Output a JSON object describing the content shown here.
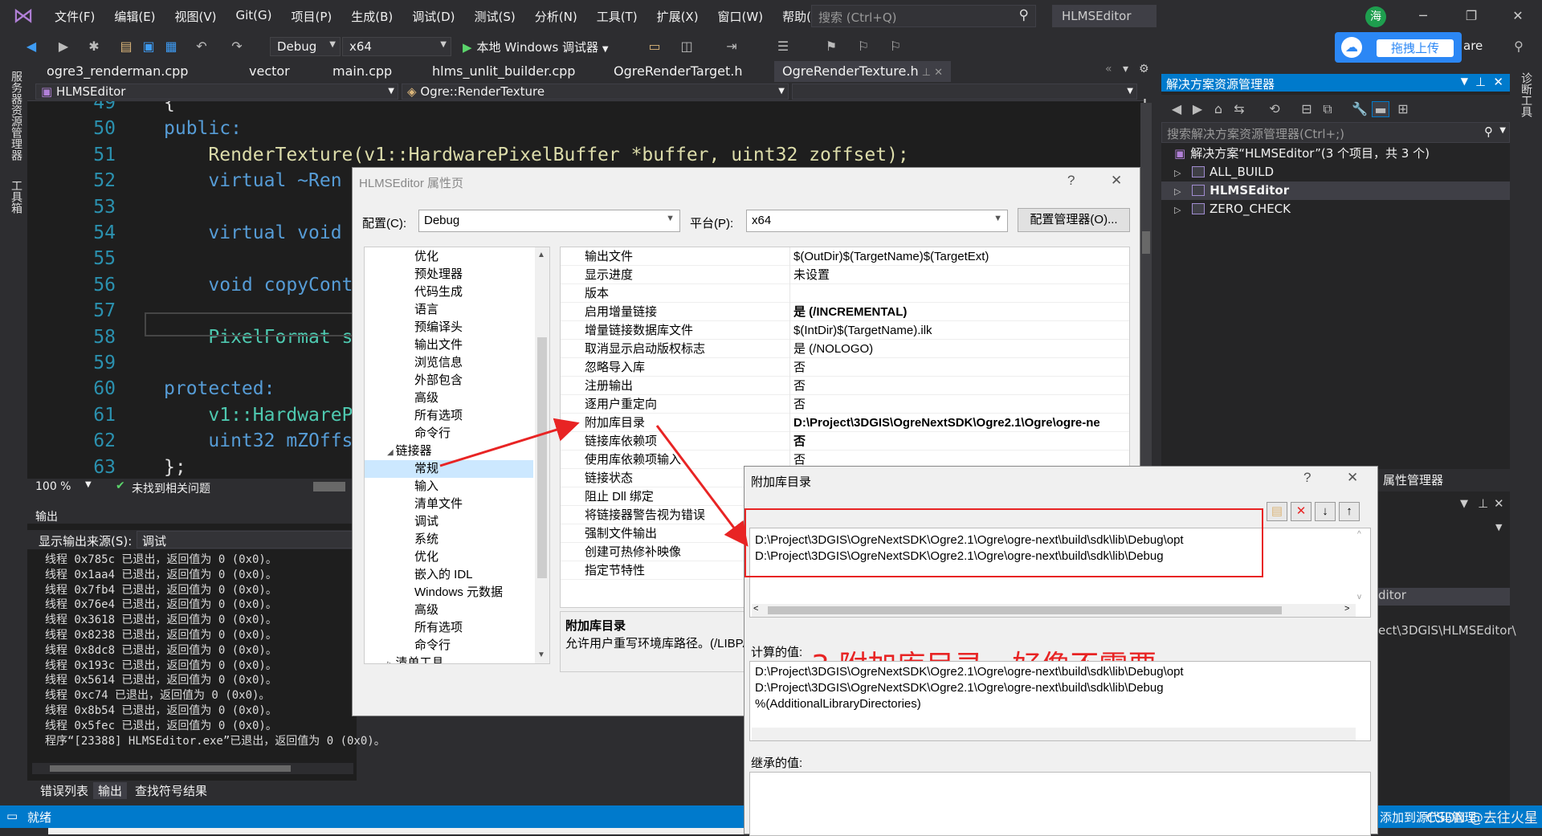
{
  "menubar": {
    "items": [
      "文件(F)",
      "编辑(E)",
      "视图(V)",
      "Git(G)",
      "项目(P)",
      "生成(B)",
      "调试(D)",
      "测试(S)",
      "分析(N)",
      "工具(T)",
      "扩展(X)",
      "窗口(W)",
      "帮助(H)"
    ],
    "search_placeholder": "搜索 (Ctrl+Q)",
    "solution_name": "HLMSEditor",
    "avatar_text": "海"
  },
  "toolbar": {
    "config": "Debug",
    "platform": "x64",
    "run_label": "本地 Windows 调试器",
    "upload_label": "拖拽上传",
    "share_suffix": "are"
  },
  "left_rail": {
    "server_explorer": "服务器资源管理器",
    "toolbox": "工具箱"
  },
  "right_rail": {
    "diagnostics": "诊断工具"
  },
  "doc_tabs": [
    "ogre3_renderman.cpp",
    "vector",
    "main.cpp",
    "hlms_unlit_builder.cpp",
    "OgreRenderTarget.h",
    "OgreRenderTexture.h"
  ],
  "nav": {
    "project": "HLMSEditor",
    "scope": "Ogre::RenderTexture"
  },
  "editor": {
    "lines": [
      {
        "n": "49",
        "code": "{"
      },
      {
        "n": "50",
        "code": "public:"
      },
      {
        "n": "51",
        "code": "    RenderTexture(v1::HardwarePixelBuffer *buffer, uint32 zoffset);"
      },
      {
        "n": "52",
        "code": "    virtual ~Ren"
      },
      {
        "n": "53",
        "code": ""
      },
      {
        "n": "54",
        "code": "    virtual void"
      },
      {
        "n": "55",
        "code": ""
      },
      {
        "n": "56",
        "code": "    void copyCont"
      },
      {
        "n": "57",
        "code": ""
      },
      {
        "n": "58",
        "code": "    PixelFormat s"
      },
      {
        "n": "59",
        "code": ""
      },
      {
        "n": "60",
        "code": "protected:"
      },
      {
        "n": "61",
        "code": "    v1::HardwareP"
      },
      {
        "n": "62",
        "code": "    uint32 mZOffs"
      },
      {
        "n": "63",
        "code": "};"
      }
    ],
    "zoom": "100 %",
    "issues": "未找到相关问题"
  },
  "output": {
    "title": "输出",
    "source_label": "显示输出来源(S):",
    "source_value": "调试",
    "lines": [
      "线程 0x785c 已退出，返回值为 0 (0x0)。",
      "线程 0x1aa4 已退出，返回值为 0 (0x0)。",
      "线程 0x7fb4 已退出，返回值为 0 (0x0)。",
      "线程 0x76e4 已退出，返回值为 0 (0x0)。",
      "线程 0x3618 已退出，返回值为 0 (0x0)。",
      "线程 0x8238 已退出，返回值为 0 (0x0)。",
      "线程 0x8dc8 已退出，返回值为 0 (0x0)。",
      "线程 0x193c 已退出，返回值为 0 (0x0)。",
      "线程 0x5614 已退出，返回值为 0 (0x0)。",
      "线程 0xc74 已退出，返回值为 0 (0x0)。",
      "线程 0x8b54 已退出，返回值为 0 (0x0)。",
      "线程 0x5fec 已退出，返回值为 0 (0x0)。",
      "程序“[23388] HLMSEditor.exe”已退出，返回值为 0 (0x0)。"
    ],
    "tabs": [
      "错误列表",
      "输出",
      "查找符号结果"
    ]
  },
  "statusbar": {
    "ready": "就绪",
    "add_to_source": "添加到源代码管理",
    "watermark": "CSDN @去往火星"
  },
  "solution_explorer": {
    "title": "解决方案资源管理器",
    "search_placeholder": "搜索解决方案资源管理器(Ctrl+;)",
    "root": "解决方案“HLMSEditor”(3 个项目，共 3 个)",
    "projects": [
      "ALL_BUILD",
      "HLMSEditor",
      "ZERO_CHECK"
    ],
    "property_manager": "属性管理器",
    "partial_editor": "ditor",
    "partial_path": "ect\\3DGIS\\HLMSEditor\\"
  },
  "prop_dialog": {
    "title": "HLMSEditor 属性页",
    "config_label": "配置(C):",
    "config_value": "Debug",
    "platform_label": "平台(P):",
    "platform_value": "x64",
    "config_mgr": "配置管理器(O)...",
    "tree": [
      {
        "label": "优化",
        "indent": 2
      },
      {
        "label": "预处理器",
        "indent": 2
      },
      {
        "label": "代码生成",
        "indent": 2
      },
      {
        "label": "语言",
        "indent": 2
      },
      {
        "label": "预编译头",
        "indent": 2
      },
      {
        "label": "输出文件",
        "indent": 2
      },
      {
        "label": "浏览信息",
        "indent": 2
      },
      {
        "label": "外部包含",
        "indent": 2
      },
      {
        "label": "高级",
        "indent": 2
      },
      {
        "label": "所有选项",
        "indent": 2
      },
      {
        "label": "命令行",
        "indent": 2
      },
      {
        "label": "链接器",
        "indent": 1
      },
      {
        "label": "常规",
        "indent": 2
      },
      {
        "label": "输入",
        "indent": 2
      },
      {
        "label": "清单文件",
        "indent": 2
      },
      {
        "label": "调试",
        "indent": 2
      },
      {
        "label": "系统",
        "indent": 2
      },
      {
        "label": "优化",
        "indent": 2
      },
      {
        "label": "嵌入的 IDL",
        "indent": 2
      },
      {
        "label": "Windows 元数据",
        "indent": 2
      },
      {
        "label": "高级",
        "indent": 2
      },
      {
        "label": "所有选项",
        "indent": 2
      },
      {
        "label": "命令行",
        "indent": 2
      },
      {
        "label": "清单工具",
        "indent": 1
      }
    ],
    "selected_tree": "常规",
    "grid": [
      {
        "k": "输出文件",
        "v": "$(OutDir)$(TargetName)$(TargetExt)"
      },
      {
        "k": "显示进度",
        "v": "未设置"
      },
      {
        "k": "版本",
        "v": ""
      },
      {
        "k": "启用增量链接",
        "v": "是 (/INCREMENTAL)",
        "bold": true
      },
      {
        "k": "增量链接数据库文件",
        "v": "$(IntDir)$(TargetName).ilk"
      },
      {
        "k": "取消显示启动版权标志",
        "v": "是 (/NOLOGO)"
      },
      {
        "k": "忽略导入库",
        "v": "否"
      },
      {
        "k": "注册输出",
        "v": "否"
      },
      {
        "k": "逐用户重定向",
        "v": "否"
      },
      {
        "k": "附加库目录",
        "v": "D:\\Project\\3DGIS\\OgreNextSDK\\Ogre2.1\\Ogre\\ogre-ne",
        "bold": true
      },
      {
        "k": "链接库依赖项",
        "v": "否",
        "bold": true
      },
      {
        "k": "使用库依赖项输入",
        "v": "否"
      },
      {
        "k": "链接状态",
        "v": ""
      },
      {
        "k": "阻止 Dll 绑定",
        "v": ""
      },
      {
        "k": "将链接器警告视为错误",
        "v": ""
      },
      {
        "k": "强制文件输出",
        "v": ""
      },
      {
        "k": "创建可热修补映像",
        "v": ""
      },
      {
        "k": "指定节特性",
        "v": ""
      }
    ],
    "desc_title": "附加库目录",
    "desc_text": "允许用户重写环境库路径。(/LIBPA"
  },
  "libdir_dialog": {
    "title": "附加库目录",
    "entries": [
      "D:\\Project\\3DGIS\\OgreNextSDK\\Ogre2.1\\Ogre\\ogre-next\\build\\sdk\\lib\\Debug\\opt",
      "D:\\Project\\3DGIS\\OgreNextSDK\\Ogre2.1\\Ogre\\ogre-next\\build\\sdk\\lib\\Debug"
    ],
    "annotation": "3.附加库目录，好像不需要",
    "computed_label": "计算的值:",
    "computed": [
      "D:\\Project\\3DGIS\\OgreNextSDK\\Ogre2.1\\Ogre\\ogre-next\\build\\sdk\\lib\\Debug\\opt",
      "D:\\Project\\3DGIS\\OgreNextSDK\\Ogre2.1\\Ogre\\ogre-next\\build\\sdk\\lib\\Debug",
      "%(AdditionalLibraryDirectories)"
    ],
    "inherited_label": "继承的值:"
  },
  "colors": {
    "accent": "#007acc",
    "annotation": "#e82424",
    "upload": "#2b87f5"
  }
}
